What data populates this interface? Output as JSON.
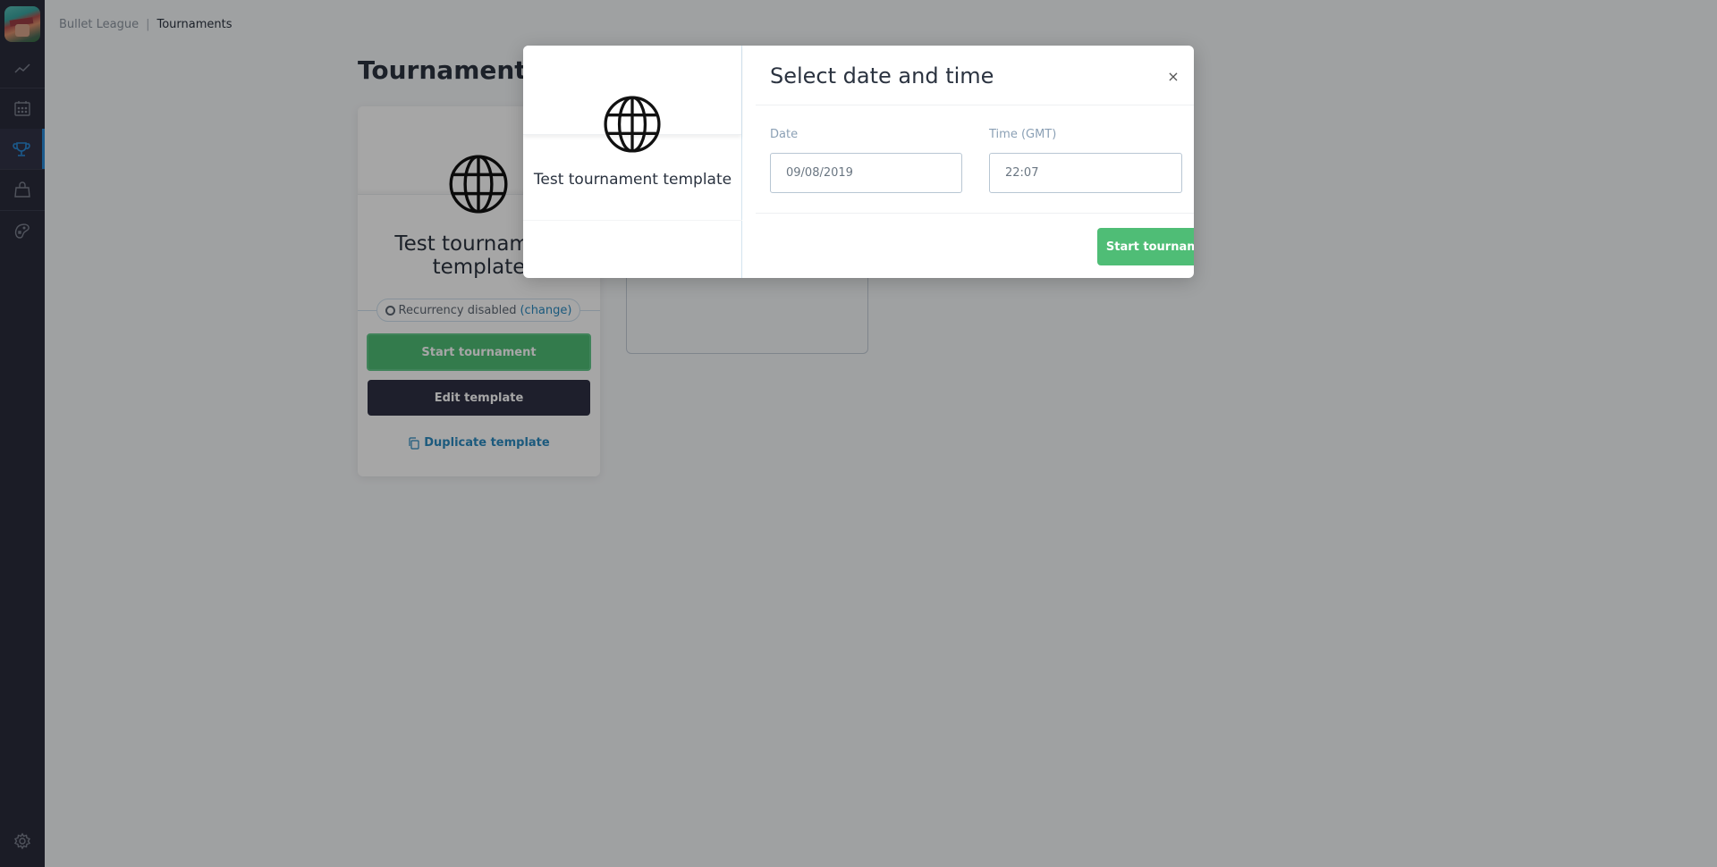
{
  "breadcrumb": {
    "root": "Bullet League",
    "separator": "|",
    "current": "Tournaments"
  },
  "sidebar": {
    "logo_alt": "Bullet League game logo",
    "items": [
      {
        "icon": "chart-line-icon",
        "label": "Analytics",
        "active": false
      },
      {
        "icon": "calendar-icon",
        "label": "Calendar",
        "active": false
      },
      {
        "icon": "trophy-icon",
        "label": "Tournaments",
        "active": true
      },
      {
        "icon": "shopping-bag-icon",
        "label": "Store",
        "active": false
      },
      {
        "icon": "gamepad-icon",
        "label": "Game",
        "active": false
      }
    ],
    "settings_icon": "gear-icon",
    "active_color": "#2a8ad8"
  },
  "page": {
    "title": "Tournament templates"
  },
  "template_card": {
    "icon": "globe-icon",
    "name": "Test tournament template",
    "recurrency_text": "Recurrency disabled",
    "recurrency_change": "(change)",
    "start_label": "Start tournament",
    "edit_label": "Edit template",
    "duplicate_label": "Duplicate template"
  },
  "modal": {
    "title": "Select date and time",
    "close_label": "×",
    "template_icon": "globe-icon",
    "template_name": "Test tournament template",
    "date_label": "Date",
    "date_value": "09/08/2019",
    "time_label": "Time (GMT)",
    "time_value": "22:07",
    "submit_label": "Start tournament",
    "submit_color": "#4fbd76"
  }
}
